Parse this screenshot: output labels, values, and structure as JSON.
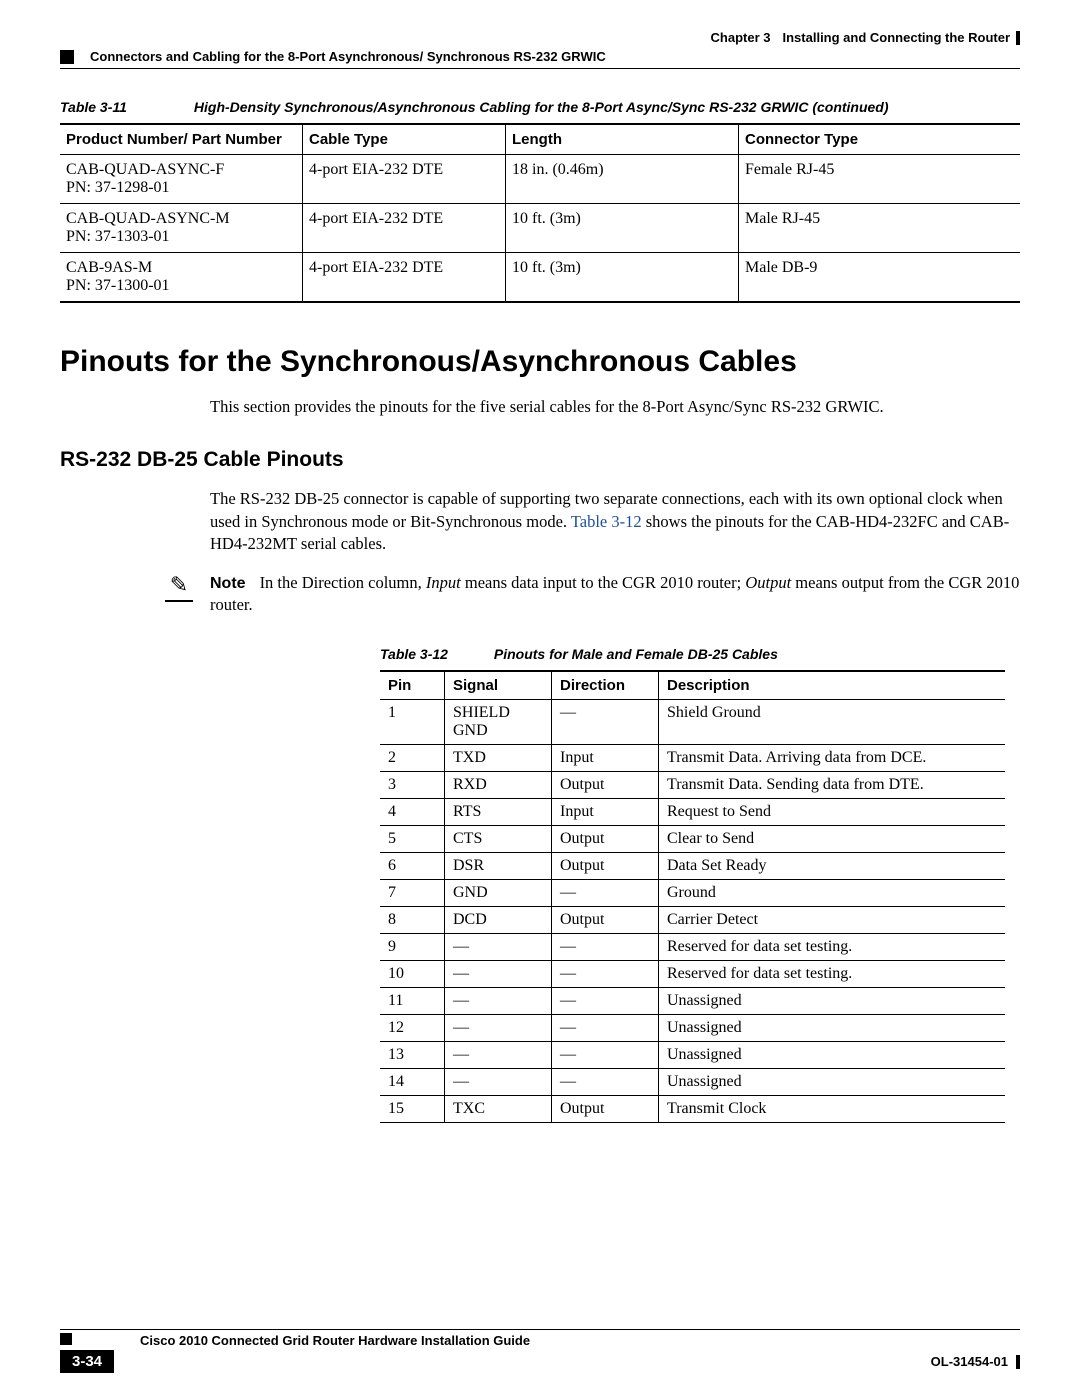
{
  "header": {
    "chapter": "Chapter 3",
    "chapterTitle": "Installing and Connecting the Router",
    "section": "Connectors and Cabling for the 8-Port Asynchronous/ Synchronous RS-232 GRWIC"
  },
  "table311": {
    "label": "Table 3-11",
    "caption": "High-Density Synchronous/Asynchronous Cabling for the 8-Port Async/Sync RS-232 GRWIC (continued)",
    "headers": [
      "Product Number/ Part Number",
      "Cable Type",
      "Length",
      "Connector Type"
    ],
    "rows": [
      {
        "pn": "CAB-QUAD-ASYNC-F",
        "pnsub": "PN: 37-1298-01",
        "type": "4-port EIA-232 DTE",
        "len": "18 in. (0.46m)",
        "conn": "Female RJ-45"
      },
      {
        "pn": "CAB-QUAD-ASYNC-M",
        "pnsub": "PN: 37-1303-01",
        "type": "4-port EIA-232 DTE",
        "len": "10 ft. (3m)",
        "conn": "Male RJ-45"
      },
      {
        "pn": "CAB-9AS-M",
        "pnsub": "PN: 37-1300-01",
        "type": "4-port EIA-232 DTE",
        "len": "10 ft. (3m)",
        "conn": "Male DB-9"
      }
    ]
  },
  "section1": {
    "title": "Pinouts for the Synchronous/Asynchronous Cables",
    "intro": "This section provides the pinouts for the five serial cables for the 8-Port Async/Sync RS-232 GRWIC."
  },
  "section2": {
    "title": "RS-232 DB-25 Cable Pinouts",
    "para_a": "The RS-232 DB-25 connector is capable of supporting two separate connections, each with its own optional clock when used in Synchronous mode or Bit-Synchronous mode. ",
    "link": "Table 3-12",
    "para_b": " shows the pinouts for the CAB-HD4-232FC and CAB-HD4-232MT serial cables."
  },
  "note": {
    "label": "Note",
    "pre": "In the Direction column, ",
    "em1": "Input",
    "mid": " means data input to the CGR 2010 router; ",
    "em2": "Output",
    "post": " means output from the CGR 2010 router."
  },
  "table312": {
    "label": "Table 3-12",
    "caption": "Pinouts for Male and Female DB-25 Cables",
    "headers": [
      "Pin",
      "Signal",
      "Direction",
      "Description"
    ],
    "rows": [
      {
        "pin": "1",
        "sig": "SHIELD GND",
        "dir": "—",
        "desc": "Shield Ground"
      },
      {
        "pin": "2",
        "sig": "TXD",
        "dir": "Input",
        "desc": "Transmit Data. Arriving data from DCE."
      },
      {
        "pin": "3",
        "sig": "RXD",
        "dir": "Output",
        "desc": "Transmit Data. Sending data from DTE."
      },
      {
        "pin": "4",
        "sig": "RTS",
        "dir": "Input",
        "desc": "Request to Send"
      },
      {
        "pin": "5",
        "sig": "CTS",
        "dir": "Output",
        "desc": "Clear to Send"
      },
      {
        "pin": "6",
        "sig": "DSR",
        "dir": "Output",
        "desc": "Data Set Ready"
      },
      {
        "pin": "7",
        "sig": "GND",
        "dir": "—",
        "desc": "Ground"
      },
      {
        "pin": "8",
        "sig": "DCD",
        "dir": "Output",
        "desc": "Carrier Detect"
      },
      {
        "pin": "9",
        "sig": "—",
        "dir": "—",
        "desc": "Reserved for data set testing."
      },
      {
        "pin": "10",
        "sig": "—",
        "dir": "—",
        "desc": "Reserved for data set testing."
      },
      {
        "pin": "11",
        "sig": "—",
        "dir": "—",
        "desc": "Unassigned"
      },
      {
        "pin": "12",
        "sig": "—",
        "dir": "—",
        "desc": "Unassigned"
      },
      {
        "pin": "13",
        "sig": "—",
        "dir": "—",
        "desc": "Unassigned"
      },
      {
        "pin": "14",
        "sig": "—",
        "dir": "—",
        "desc": "Unassigned"
      },
      {
        "pin": "15",
        "sig": "TXC",
        "dir": "Output",
        "desc": "Transmit Clock"
      }
    ]
  },
  "footer": {
    "guide": "Cisco 2010 Connected Grid Router Hardware Installation Guide",
    "page": "3-34",
    "doc": "OL-31454-01"
  }
}
